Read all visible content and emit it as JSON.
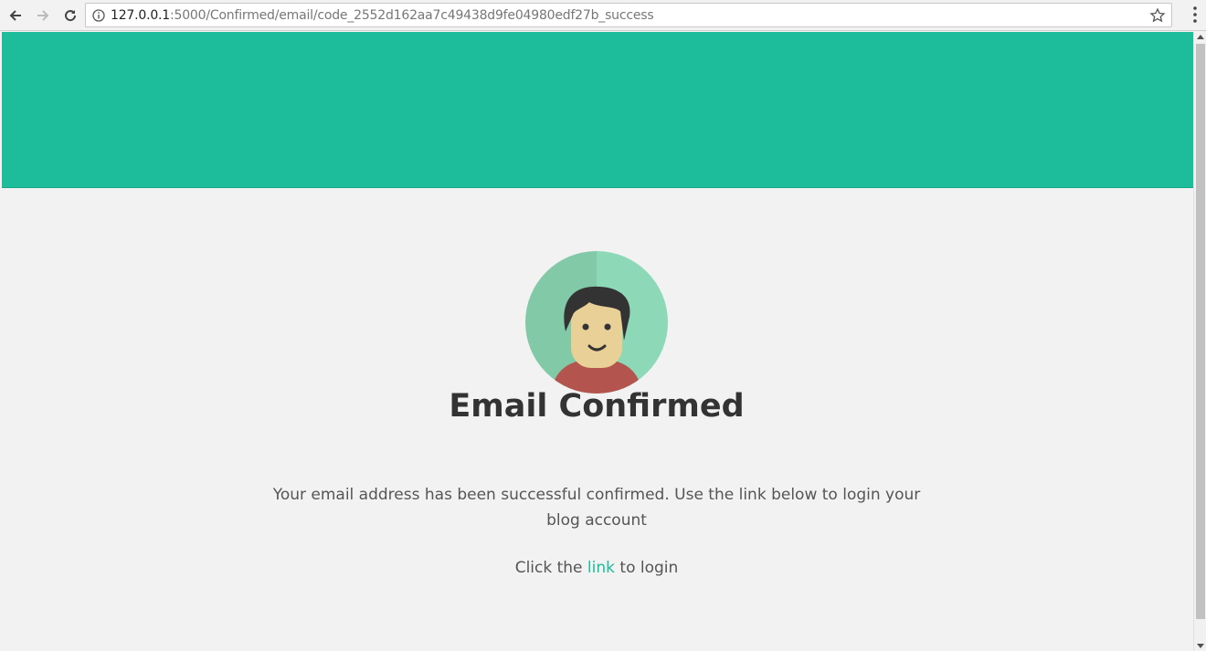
{
  "browser": {
    "url_host": "127.0.0.1",
    "url_rest": ":5000/Confirmed/email/code_2552d162aa7c49438d9fe04980edf27b_success",
    "back_icon": "arrow-left-icon",
    "forward_icon": "arrow-right-icon",
    "reload_icon": "reload-icon",
    "info_icon": "info-icon",
    "bookmark_icon": "star-icon",
    "menu_icon": "kebab-menu-icon"
  },
  "colors": {
    "accent": "#1dbc9a",
    "background": "#f2f2f2",
    "heading": "#333333",
    "body_text": "#555555"
  },
  "page": {
    "title": "Email Confirmed",
    "message": "Your email address has been successful confirmed. Use the link below to login your blog account",
    "cta_prefix": "Click the ",
    "cta_link": "link",
    "cta_suffix": " to login",
    "avatar_icon": "user-avatar-icon"
  }
}
